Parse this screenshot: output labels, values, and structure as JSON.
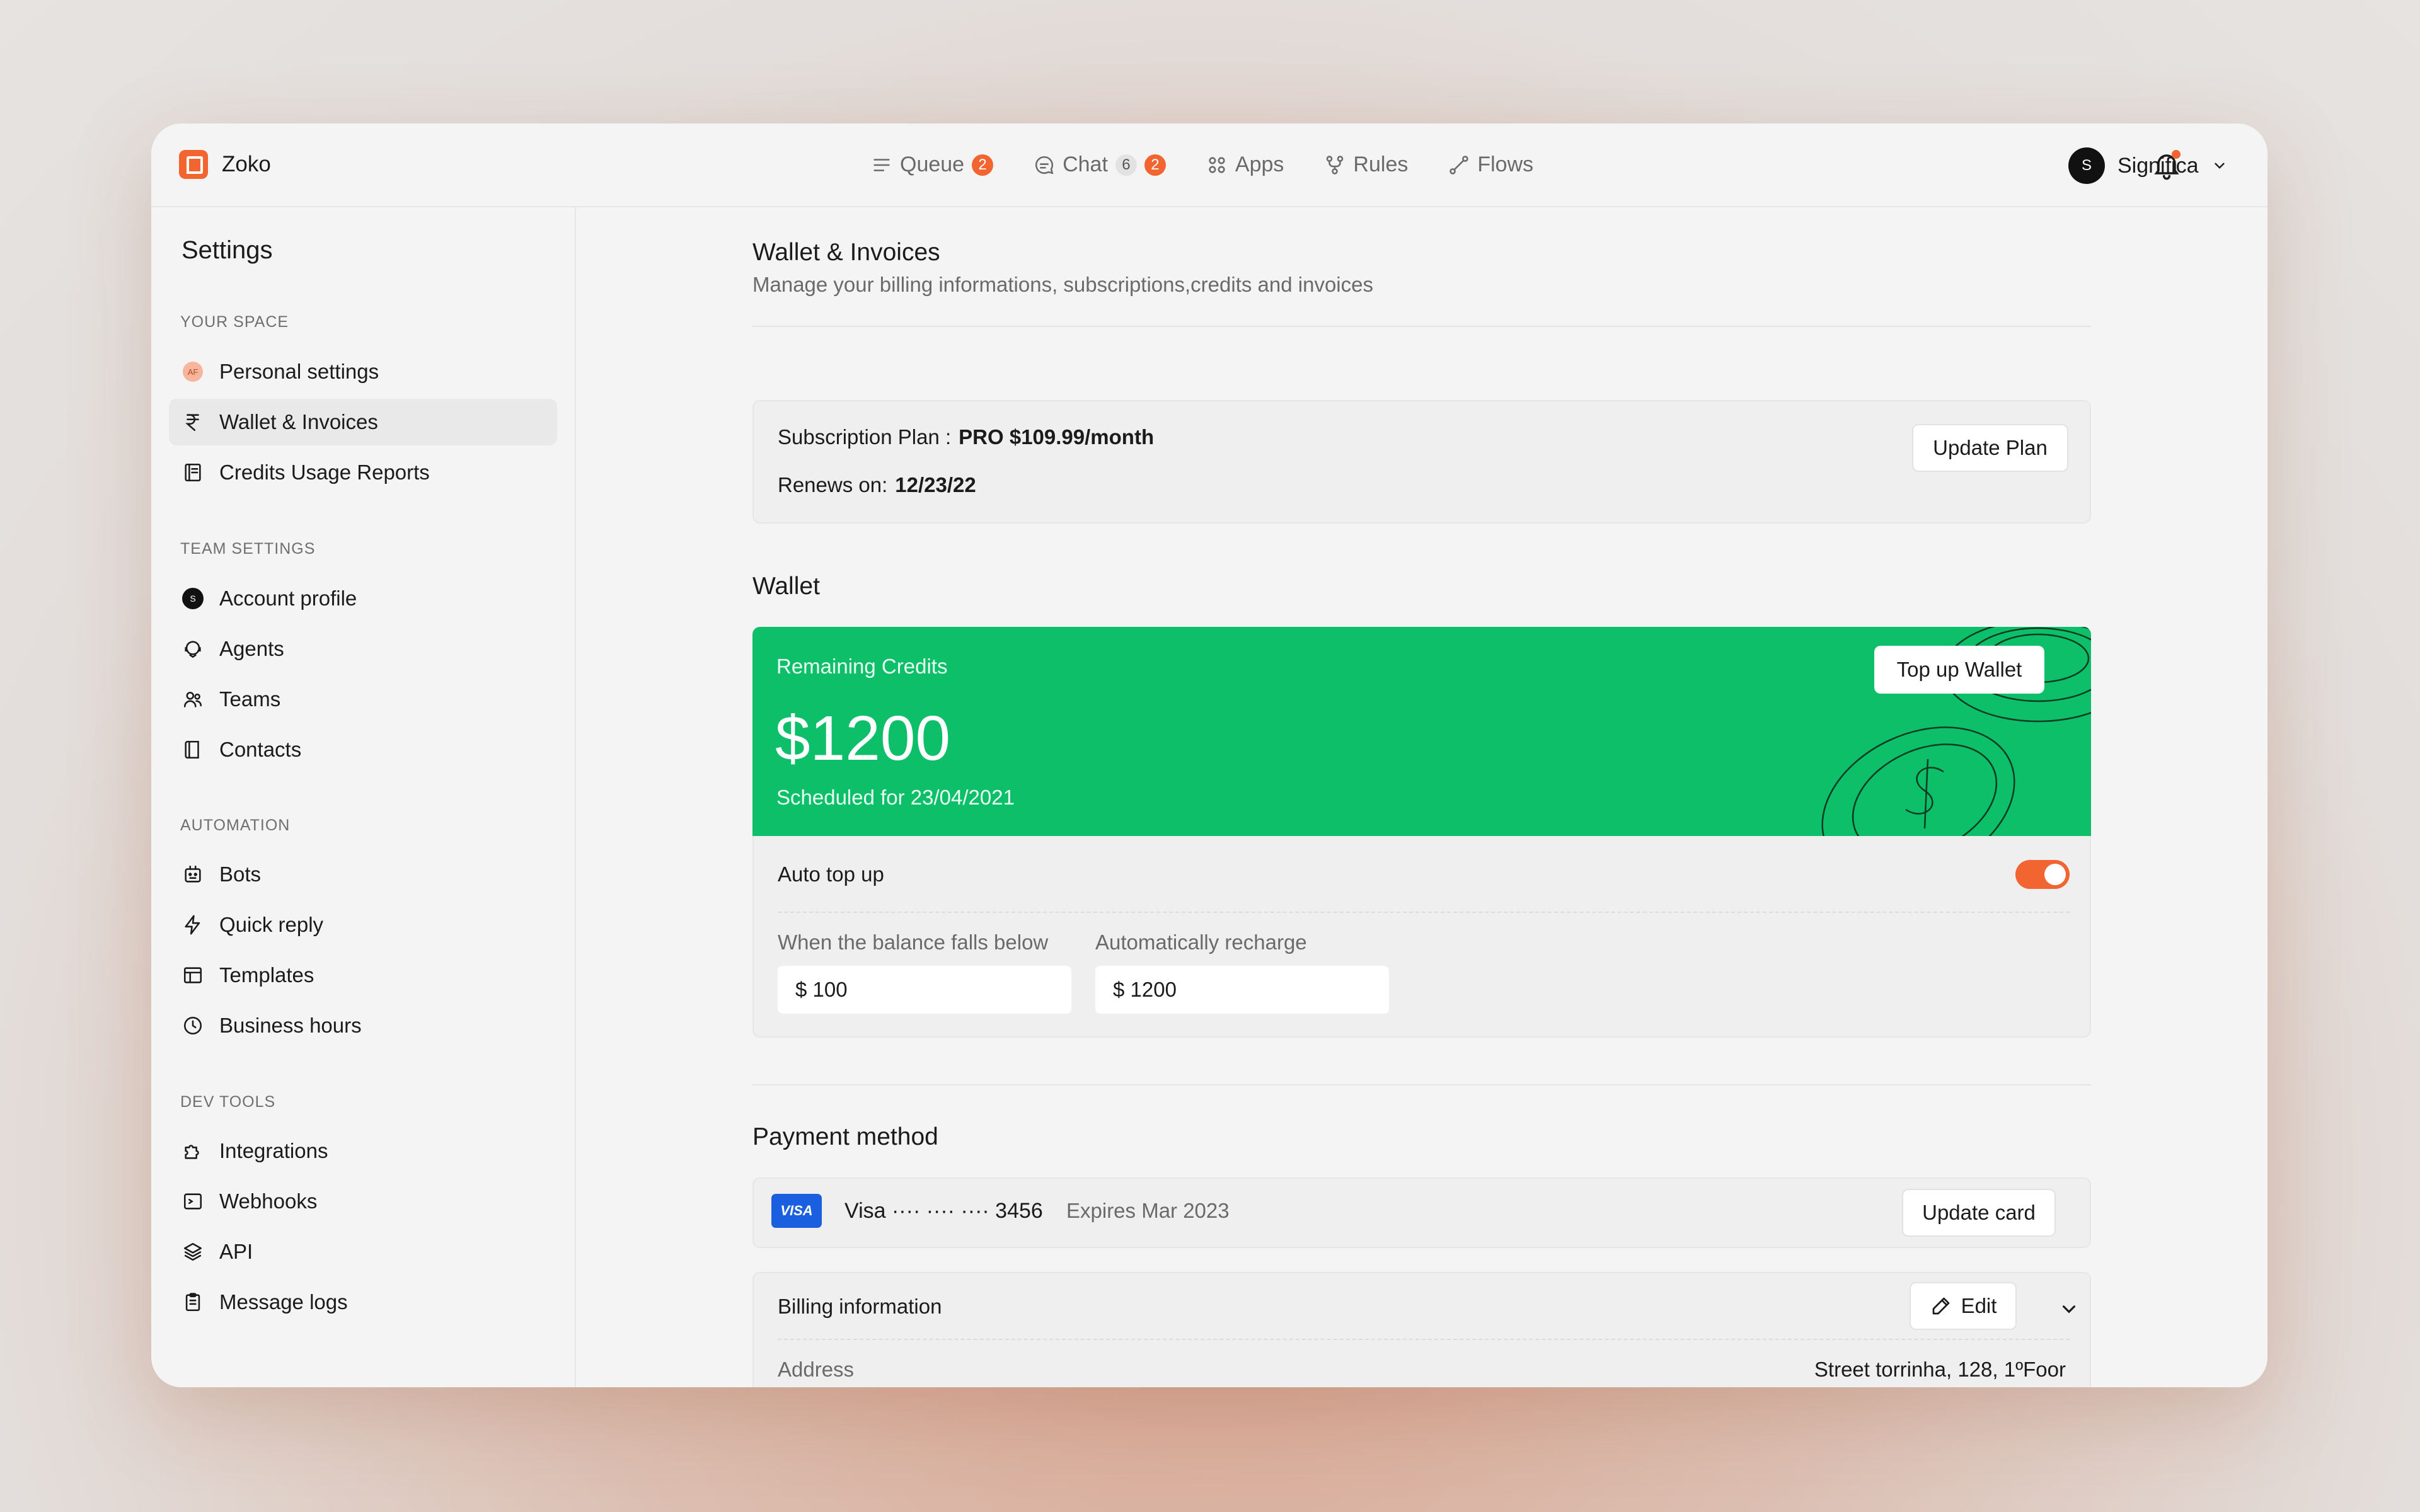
{
  "app": {
    "name": "Zoko"
  },
  "nav": [
    {
      "label": "Queue",
      "icon": "list-icon",
      "badges": [
        {
          "text": "2",
          "style": "red"
        }
      ]
    },
    {
      "label": "Chat",
      "icon": "chat-icon",
      "badges": [
        {
          "text": "6",
          "style": "grey"
        },
        {
          "text": "2",
          "style": "red"
        }
      ]
    },
    {
      "label": "Apps",
      "icon": "apps-grid-icon",
      "badges": []
    },
    {
      "label": "Rules",
      "icon": "rules-branch-icon",
      "badges": []
    },
    {
      "label": "Flows",
      "icon": "flows-icon",
      "badges": []
    }
  ],
  "user": {
    "initial": "S",
    "name": "Significa"
  },
  "sidebar": {
    "title": "Settings",
    "sections": [
      {
        "label": "YOUR SPACE",
        "items": [
          {
            "label": "Personal settings",
            "icon": "avatar-af-icon",
            "avatar_text": "AF"
          },
          {
            "label": "Wallet & Invoices",
            "icon": "rupee-icon",
            "active": true
          },
          {
            "label": "Credits Usage Reports",
            "icon": "report-icon"
          }
        ]
      },
      {
        "label": "TEAM SETTINGS",
        "items": [
          {
            "label": "Account profile",
            "icon": "account-avatar-icon",
            "avatar_text": "S"
          },
          {
            "label": "Agents",
            "icon": "agents-icon"
          },
          {
            "label": "Teams",
            "icon": "teams-icon"
          },
          {
            "label": "Contacts",
            "icon": "contacts-book-icon"
          }
        ]
      },
      {
        "label": "AUTOMATION",
        "items": [
          {
            "label": "Bots",
            "icon": "bot-icon"
          },
          {
            "label": "Quick reply",
            "icon": "lightning-icon"
          },
          {
            "label": "Templates",
            "icon": "template-icon"
          },
          {
            "label": "Business hours",
            "icon": "clock-icon"
          }
        ]
      },
      {
        "label": "DEV TOOLS",
        "items": [
          {
            "label": "Integrations",
            "icon": "puzzle-icon"
          },
          {
            "label": "Webhooks",
            "icon": "terminal-icon"
          },
          {
            "label": "API",
            "icon": "layers-icon"
          },
          {
            "label": "Message logs",
            "icon": "clipboard-icon"
          }
        ]
      }
    ]
  },
  "page": {
    "title": "Wallet & Invoices",
    "subtitle": "Manage your billing informations, subscriptions,credits and invoices"
  },
  "subscription": {
    "plan_label": "Subscription Plan :",
    "plan_value": "PRO $109.99/month",
    "renews_label": "Renews on:",
    "renews_value": "12/23/22",
    "update_button": "Update Plan"
  },
  "wallet": {
    "title": "Wallet",
    "remaining_label": "Remaining Credits",
    "amount": "$1200",
    "scheduled": "Scheduled for 23/04/2021",
    "top_up_button": "Top up Wallet",
    "auto_top_up_label": "Auto top up",
    "auto_top_up_enabled": true,
    "threshold_label": "When the balance falls below",
    "threshold_value": "$ 100",
    "recharge_label": "Automatically recharge",
    "recharge_value": "$ 1200"
  },
  "payment": {
    "title": "Payment method",
    "card_brand_badge": "VISA",
    "card_text": "Visa ···· ···· ···· 3456",
    "expires": "Expires Mar 2023",
    "update_button": "Update card"
  },
  "billing": {
    "label": "Billing information",
    "edit_button": "Edit",
    "address_label": "Address",
    "address_value": "Street torrinha, 128, 1ºFoor"
  },
  "colors": {
    "accent": "#f26430",
    "wallet_green": "#0cbf68",
    "visa_blue": "#1a5fe0"
  }
}
